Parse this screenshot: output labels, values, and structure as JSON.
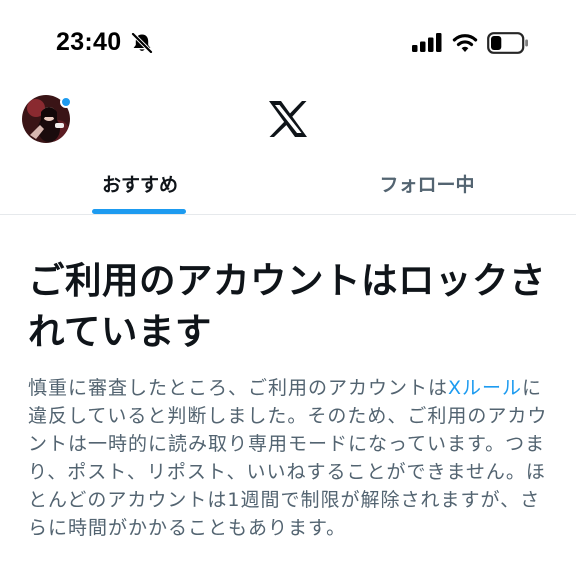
{
  "status_bar": {
    "time": "23:40",
    "icons": [
      "bell-slash-icon",
      "cellular-signal-icon",
      "wifi-icon",
      "battery-icon"
    ],
    "battery_level": 0.35
  },
  "header": {
    "logo": "x-logo-icon",
    "avatar": "user-avatar",
    "notification_dot": true
  },
  "tabs": [
    {
      "label": "おすすめ",
      "active": true
    },
    {
      "label": "フォロー中",
      "active": false
    }
  ],
  "lock_notice": {
    "title": "ご利用のアカウントはロックされています",
    "body_before_link": "慎重に審査したところ、ご利用のアカウントは",
    "link_text": "Xルール",
    "body_after_link": "に違反していると判断しました。そのため、ご利用のアカウントは一時的に読み取り専用モードになっています。つまり、ポスト、リポスト、いいねすることができません。ほとんどのアカウントは1週間で制限が解除されますが、さらに時間がかかることもあります。"
  },
  "colors": {
    "accent": "#1d9bf0",
    "text_primary": "#0f1419",
    "text_secondary": "#536471",
    "divider": "#e6e9ec"
  }
}
